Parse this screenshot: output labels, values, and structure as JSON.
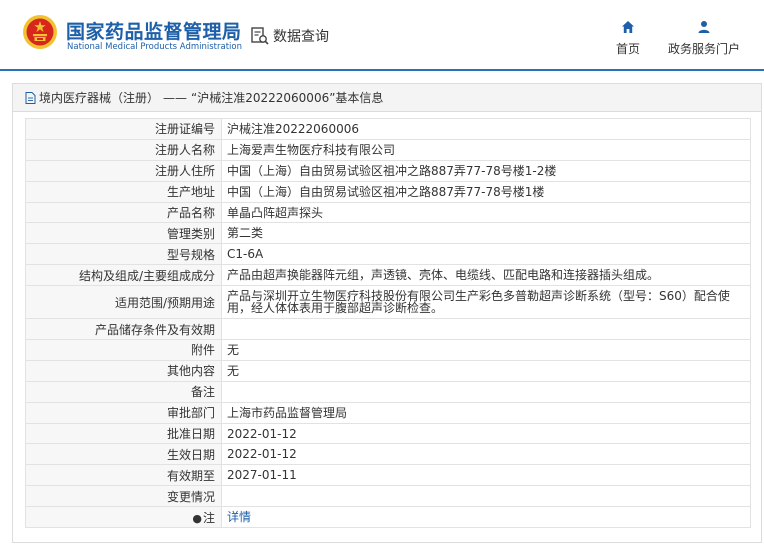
{
  "header": {
    "brand_cn": "国家药品监督管理局",
    "brand_en": "National Medical Products Administration",
    "query_label": "数据查询",
    "nav": [
      {
        "label": "首页",
        "icon": "home-icon"
      },
      {
        "label": "政务服务门户",
        "icon": "user-icon"
      }
    ]
  },
  "breadcrumb": {
    "category": "境内医疗器械（注册）",
    "separator": "——",
    "record": "“沪械注准20222060006”基本信息"
  },
  "fields": [
    {
      "label": "注册证编号",
      "value": "沪械注准20222060006"
    },
    {
      "label": "注册人名称",
      "value": "上海爱声生物医疗科技有限公司"
    },
    {
      "label": "注册人住所",
      "value": "中国（上海）自由贸易试验区祖冲之路887弄77-78号楼1-2楼"
    },
    {
      "label": "生产地址",
      "value": "中国（上海）自由贸易试验区祖冲之路887弄77-78号楼1楼"
    },
    {
      "label": "产品名称",
      "value": "单晶凸阵超声探头"
    },
    {
      "label": "管理类别",
      "value": "第二类"
    },
    {
      "label": "型号规格",
      "value": "C1-6A"
    },
    {
      "label": "结构及组成/主要组成成分",
      "value": "产品由超声换能器阵元组，声透镜、壳体、电缆线、匹配电路和连接器插头组成。"
    },
    {
      "label": "适用范围/预期用途",
      "value": "产品与深圳开立生物医疗科技股份有限公司生产彩色多普勒超声诊断系统（型号：S60）配合使用，经人体体表用于腹部超声诊断检查。"
    },
    {
      "label": "产品储存条件及有效期",
      "value": ""
    },
    {
      "label": "附件",
      "value": "无"
    },
    {
      "label": "其他内容",
      "value": "无"
    },
    {
      "label": "备注",
      "value": ""
    },
    {
      "label": "审批部门",
      "value": "上海市药品监督管理局"
    },
    {
      "label": "批准日期",
      "value": "2022-01-12"
    },
    {
      "label": "生效日期",
      "value": "2022-01-12"
    },
    {
      "label": "有效期至",
      "value": "2027-01-11"
    },
    {
      "label": "变更情况",
      "value": ""
    }
  ],
  "note": {
    "label": "注",
    "link": "详情"
  },
  "colors": {
    "brand_blue": "#1d5fa8",
    "header_rule": "#2d6fb7",
    "emblem_red": "#d7261b",
    "emblem_gold": "#f2c230"
  }
}
